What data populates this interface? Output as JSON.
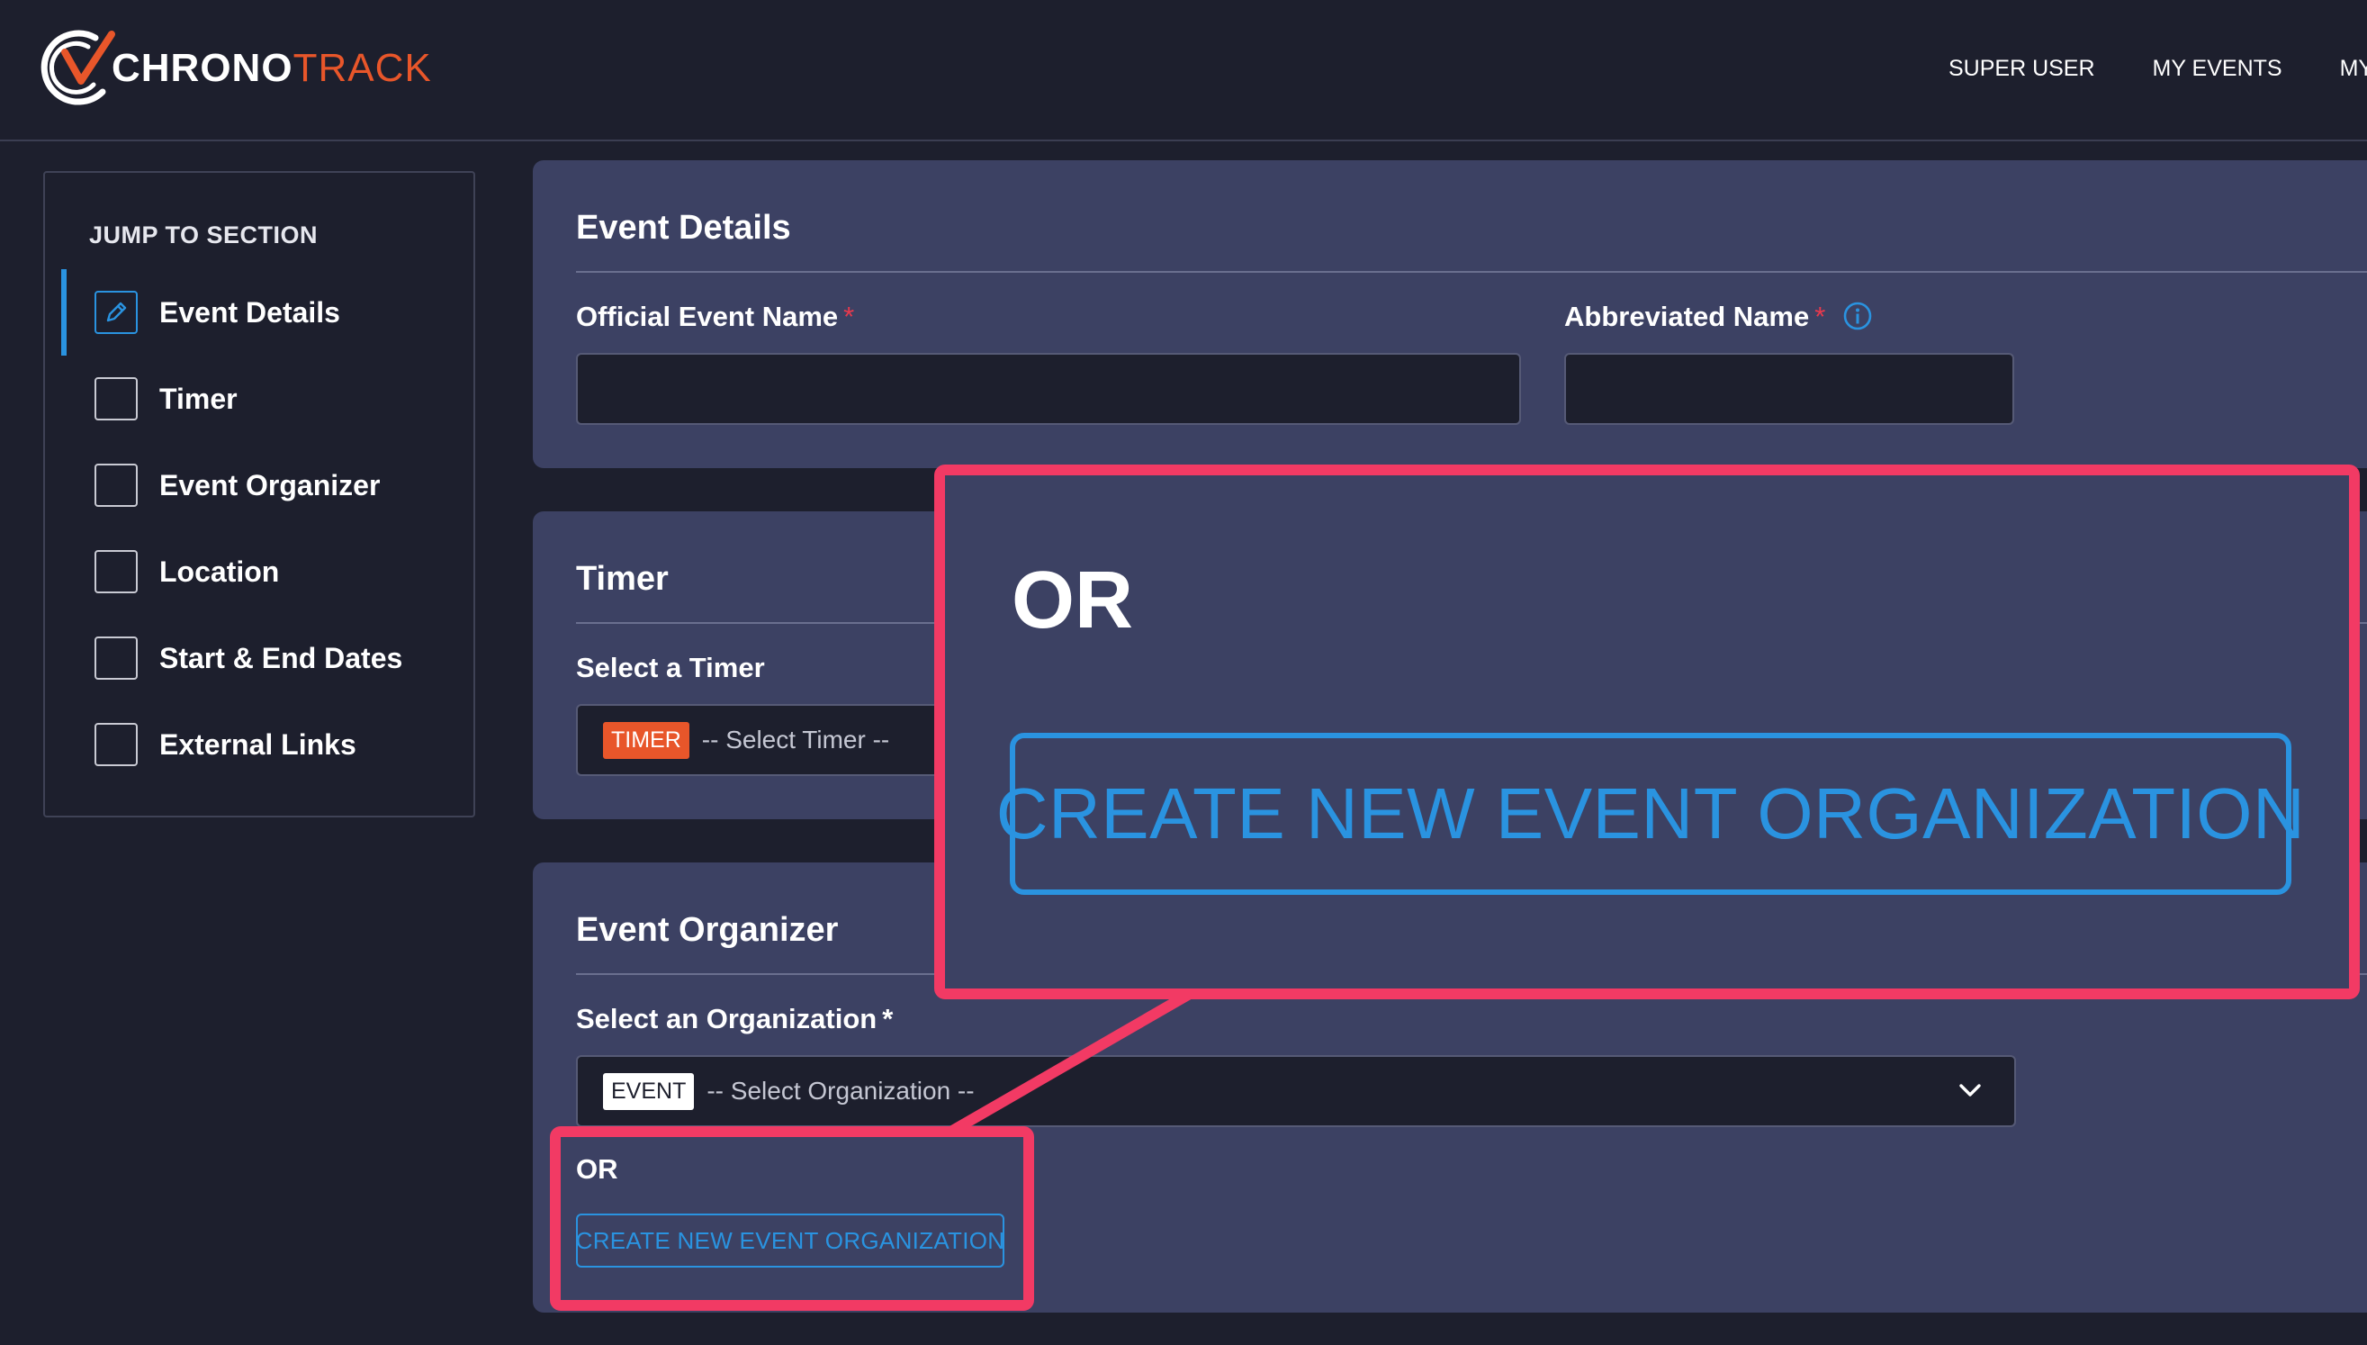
{
  "header": {
    "logo": {
      "part1": "CHRONO",
      "part2": "TRACK"
    },
    "nav": [
      "SUPER USER",
      "MY EVENTS",
      "MY"
    ]
  },
  "sidebar": {
    "title": "JUMP TO SECTION",
    "items": [
      {
        "label": "Event Details",
        "active": true,
        "icon": "pencil-icon"
      },
      {
        "label": "Timer"
      },
      {
        "label": "Event Organizer"
      },
      {
        "label": "Location"
      },
      {
        "label": "Start & End Dates"
      },
      {
        "label": "External Links"
      }
    ]
  },
  "event_details": {
    "title": "Event Details",
    "official_name_label": "Official Event Name",
    "abbreviated_name_label": "Abbreviated Name",
    "required_mark": "*",
    "official_name_value": "",
    "abbreviated_name_value": ""
  },
  "timer": {
    "title": "Timer",
    "select_label": "Select a Timer",
    "tag": "TIMER",
    "placeholder": "-- Select Timer --"
  },
  "organizer": {
    "title": "Event Organizer",
    "select_label": "Select an Organization",
    "required_mark": "*",
    "tag": "EVENT",
    "placeholder": "-- Select Organization --",
    "or_text": "OR",
    "create_button": "CREATE NEW EVENT ORGANIZATION"
  },
  "zoom_callout": {
    "or_text": "OR",
    "create_button": "CREATE NEW EVENT ORGANIZATION"
  },
  "colors": {
    "background": "#1d1f2d",
    "panel": "#3c4163",
    "accent_blue": "#2a93e0",
    "brand_orange": "#e8562a",
    "highlight_pink": "#f23a64",
    "required_red": "#e8394d"
  }
}
